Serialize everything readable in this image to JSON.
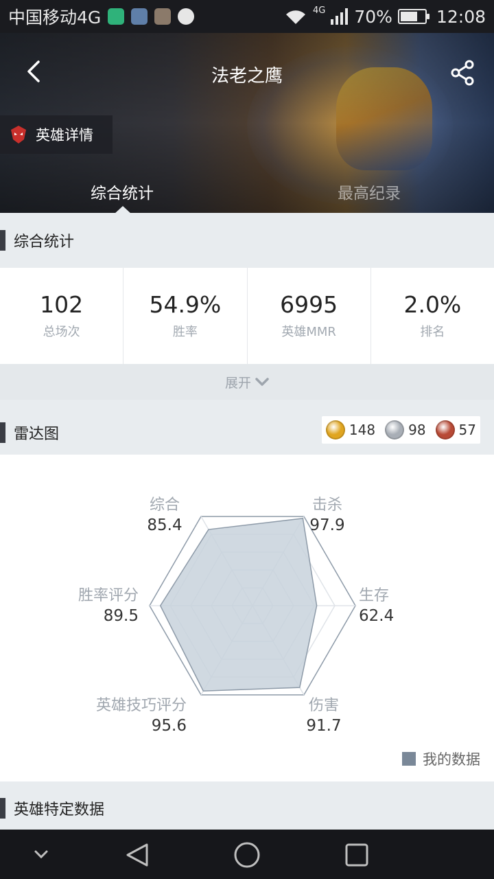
{
  "status_bar": {
    "carrier": "中国移动4G",
    "network": "4G",
    "battery": "70%",
    "battery_level": 0.7,
    "time": "12:08"
  },
  "header": {
    "title": "法老之鹰",
    "badge_label": "英雄详情",
    "tabs": [
      "综合统计",
      "最高纪录"
    ]
  },
  "overview": {
    "section_title": "综合统计",
    "stats": [
      {
        "value": "102",
        "label": "总场次"
      },
      {
        "value": "54.9%",
        "label": "胜率"
      },
      {
        "value": "6995",
        "label": "英雄MMR"
      },
      {
        "value": "2.0%",
        "label": "排名"
      }
    ],
    "expand_label": "展开"
  },
  "radar": {
    "section_title": "雷达图",
    "medals": [
      {
        "count": "148",
        "color": "#e0a520"
      },
      {
        "count": "98",
        "color": "#a8aeb6"
      },
      {
        "count": "57",
        "color": "#b84a36"
      }
    ],
    "axes": [
      {
        "name": "综合",
        "value": "85.4"
      },
      {
        "name": "击杀",
        "value": "97.9"
      },
      {
        "name": "生存",
        "value": "62.4"
      },
      {
        "name": "伤害",
        "value": "91.7"
      },
      {
        "name": "英雄技巧评分",
        "value": "95.6"
      },
      {
        "name": "胜率评分",
        "value": "89.5"
      }
    ],
    "legend_label": "我的数据",
    "colors": {
      "fill": "#c8d2dc",
      "stroke": "#8d9aa8",
      "grid": "#dfe3e8"
    }
  },
  "hero_section": {
    "section_title": "英雄特定数据"
  }
}
